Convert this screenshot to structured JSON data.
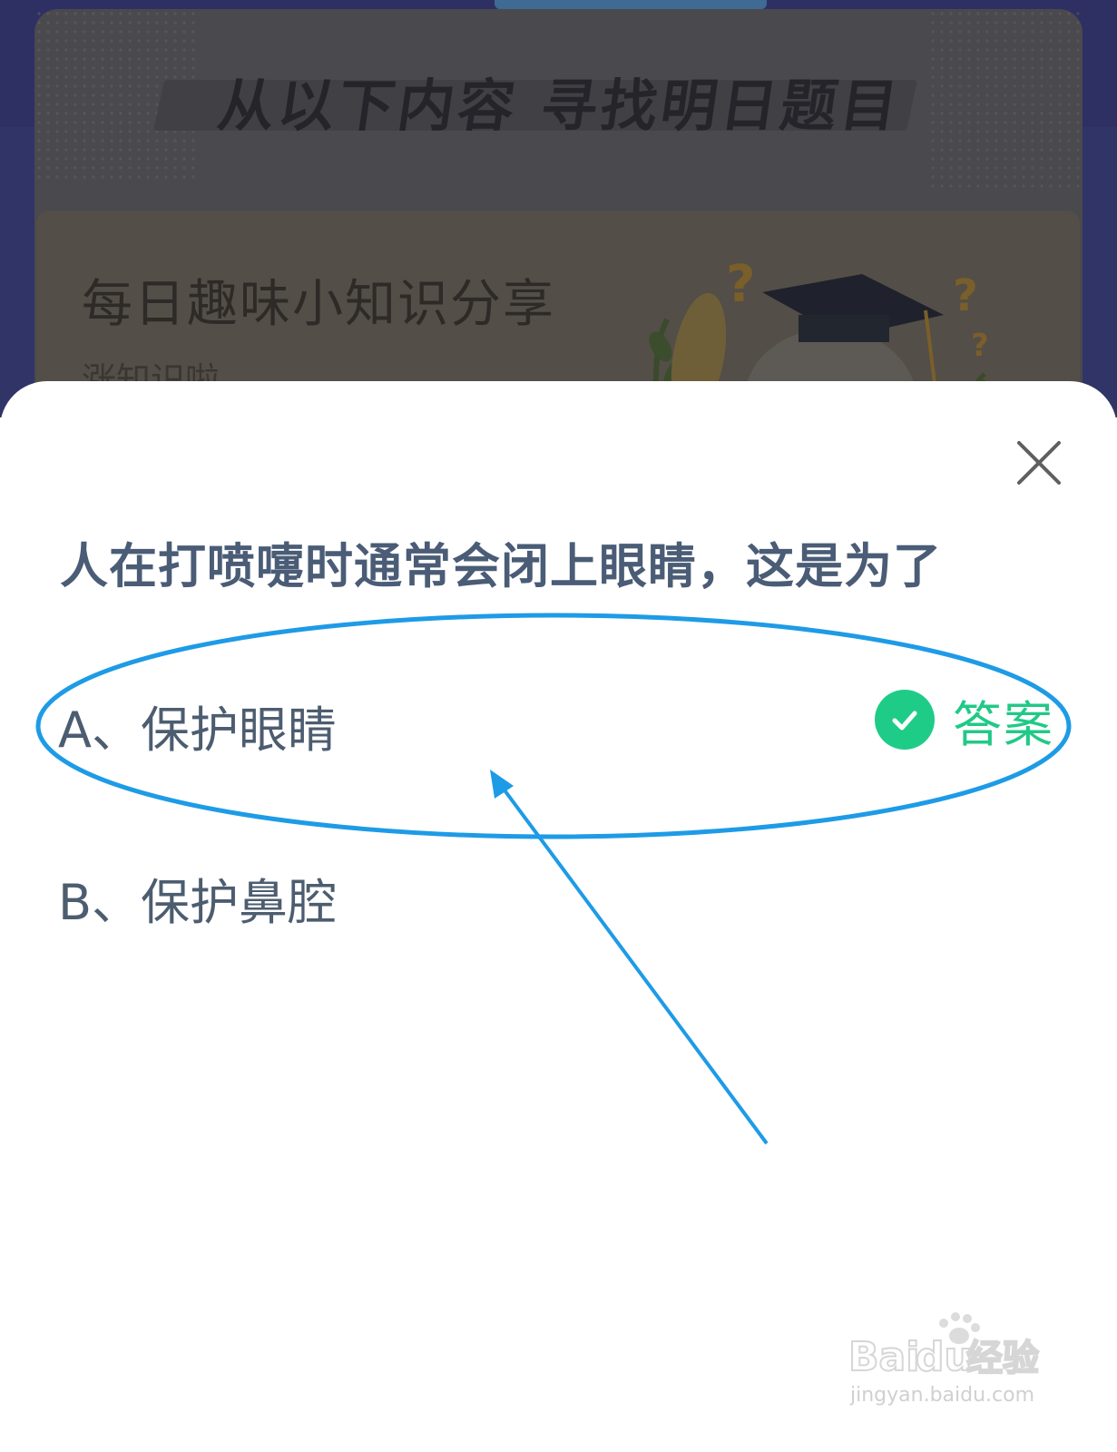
{
  "background": {
    "banner_title": "从以下内容 寻找明日题目",
    "card_title": "每日趣味小知识分享",
    "card_subtitle": "涨知识啦"
  },
  "sheet": {
    "close_icon": "close-icon",
    "question": "人在打喷嚏时通常会闭上眼睛，这是为了",
    "options": [
      {
        "label": "A、保护眼睛",
        "is_answer": true
      },
      {
        "label": "B、保护鼻腔",
        "is_answer": false
      }
    ],
    "answer_badge": {
      "icon": "check-circle-icon",
      "text": "答案",
      "color": "#21c986"
    }
  },
  "annotation": {
    "color": "#1e9be6",
    "shapes": [
      "ellipse-highlight",
      "arrow"
    ]
  },
  "watermark": {
    "logo_text": "Bai",
    "logo_text2": "du",
    "brand": "经验",
    "url": "jingyan.baidu.com"
  }
}
